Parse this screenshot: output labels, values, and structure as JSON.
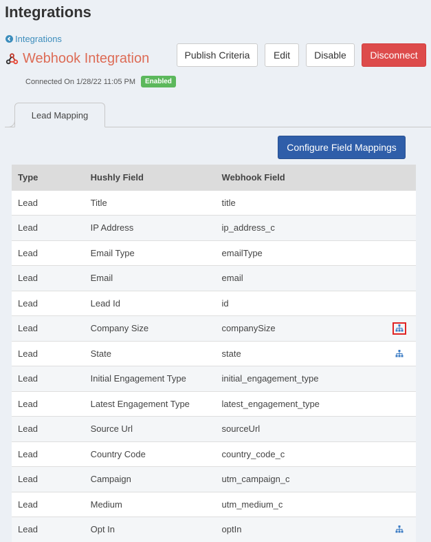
{
  "page": {
    "title": "Integrations"
  },
  "breadcrumb": {
    "label": "Integrations"
  },
  "integration": {
    "name": "Webhook Integration",
    "connected_text": "Connected On 1/28/22 11:05 PM",
    "status": "Enabled"
  },
  "toolbar": {
    "publish_label": "Publish Criteria",
    "edit_label": "Edit",
    "disable_label": "Disable",
    "disconnect_label": "Disconnect"
  },
  "tabs": [
    {
      "label": "Lead Mapping"
    }
  ],
  "configure_label": "Configure Field Mappings",
  "table": {
    "headers": [
      "Type",
      "Hushly Field",
      "Webhook Field"
    ],
    "rows": [
      {
        "type": "Lead",
        "field": "Title",
        "hook": "title"
      },
      {
        "type": "Lead",
        "field": "IP Address",
        "hook": "ip_address_c"
      },
      {
        "type": "Lead",
        "field": "Email Type",
        "hook": "emailType"
      },
      {
        "type": "Lead",
        "field": "Email",
        "hook": "email"
      },
      {
        "type": "Lead",
        "field": "Lead Id",
        "hook": "id"
      },
      {
        "type": "Lead",
        "field": "Company Size",
        "hook": "companySize",
        "icon": "sitemap-icon"
      },
      {
        "type": "Lead",
        "field": "State",
        "hook": "state",
        "icon": "sitemap-icon"
      },
      {
        "type": "Lead",
        "field": "Initial Engagement Type",
        "hook": "initial_engagement_type"
      },
      {
        "type": "Lead",
        "field": "Latest Engagement Type",
        "hook": "latest_engagement_type"
      },
      {
        "type": "Lead",
        "field": "Source Url",
        "hook": "sourceUrl"
      },
      {
        "type": "Lead",
        "field": "Country Code",
        "hook": "country_code_c"
      },
      {
        "type": "Lead",
        "field": "Campaign",
        "hook": "utm_campaign_c"
      },
      {
        "type": "Lead",
        "field": "Medium",
        "hook": "utm_medium_c"
      },
      {
        "type": "Lead",
        "field": "Opt In",
        "hook": "optIn",
        "icon": "sitemap-icon"
      }
    ]
  },
  "colors": {
    "accent": "#3c8dbc",
    "integration_name": "#dd6b55",
    "badge": "#5cb85c",
    "danger": "#dd4b4b",
    "primary": "#2f5ea9",
    "highlight": "#e02424"
  }
}
